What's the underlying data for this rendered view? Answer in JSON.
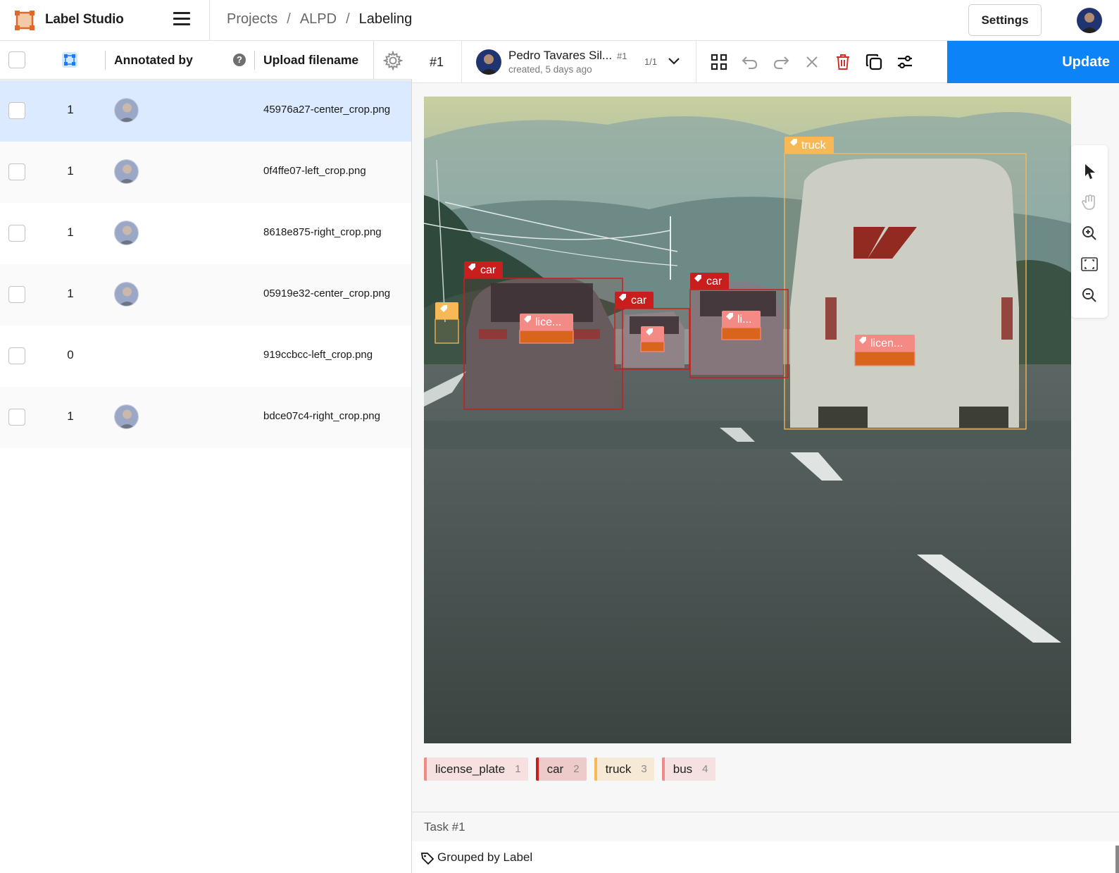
{
  "header": {
    "app_name": "Label Studio",
    "breadcrumb": [
      "Projects",
      "ALPD",
      "Labeling"
    ],
    "separator": "/",
    "settings_label": "Settings"
  },
  "table": {
    "columns": {
      "annotated_by": "Annotated by",
      "upload_filename": "Upload filename"
    },
    "rows": [
      {
        "count": "1",
        "filename": "45976a27-center_crop.png",
        "has_avatar": true,
        "selected": true
      },
      {
        "count": "1",
        "filename": "0f4ffe07-left_crop.png",
        "has_avatar": true,
        "selected": false
      },
      {
        "count": "1",
        "filename": "8618e875-right_crop.png",
        "has_avatar": true,
        "selected": false
      },
      {
        "count": "1",
        "filename": "05919e32-center_crop.png",
        "has_avatar": true,
        "selected": false
      },
      {
        "count": "0",
        "filename": "919ccbcc-left_crop.png",
        "has_avatar": false,
        "selected": false
      },
      {
        "count": "1",
        "filename": "bdce07c4-right_crop.png",
        "has_avatar": true,
        "selected": false
      }
    ]
  },
  "editor": {
    "task_id": "#1",
    "annotator_name": "Pedro Tavares Sil...",
    "annotation_id": "#1",
    "created": "created, 5 days ago",
    "annotation_count": "1/1",
    "update_label": "Update",
    "regions": [
      {
        "label": "truck",
        "text": "truck"
      },
      {
        "label": "car",
        "text": "car"
      },
      {
        "label": "car",
        "text": "car"
      },
      {
        "label": "car",
        "text": "car"
      },
      {
        "label": "license_plate",
        "text": "lice..."
      },
      {
        "label": "license_plate",
        "text": "li..."
      },
      {
        "label": "license_plate",
        "text": "licen..."
      }
    ],
    "labels": [
      {
        "name": "license_plate",
        "hotkey": "1",
        "color": "#f48a86"
      },
      {
        "name": "car",
        "hotkey": "2",
        "color": "#c81e1e"
      },
      {
        "name": "truck",
        "hotkey": "3",
        "color": "#f7b955"
      },
      {
        "name": "bus",
        "hotkey": "4",
        "color": "#f08a8a"
      }
    ],
    "task_footer": "Task #1",
    "grouped_by": "Grouped by Label"
  },
  "colors": {
    "accent": "#0c83f7",
    "selected_row": "#dbeafe",
    "car": "#c81e1e",
    "truck": "#f7b955",
    "license_plate": "#f48a86"
  }
}
